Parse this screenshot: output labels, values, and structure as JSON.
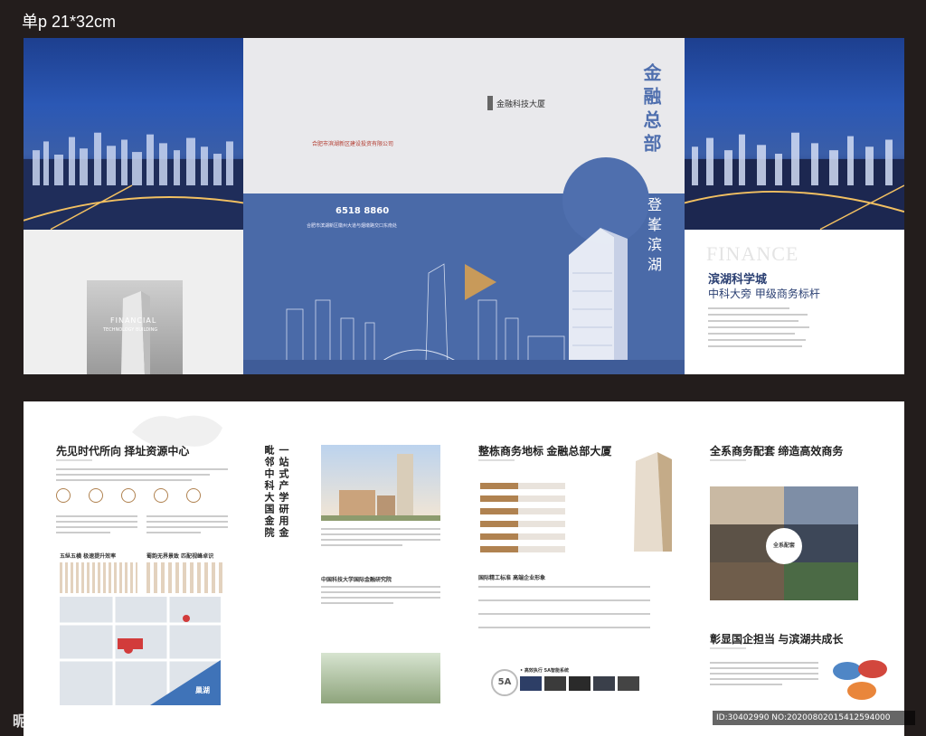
{
  "header": {
    "label": "单p  21*32cm"
  },
  "cover": {
    "logo_text": "金融科技大厦",
    "developer": "合肥市滨湖新区建设投资有限公司",
    "phone": "6518 8860",
    "address": "合肥市滨湖新区徽州大道与烟墩路交口东南处",
    "vertical_title": "金融总部",
    "vertical_subtitle": "登峯滨湖"
  },
  "back_panel": {
    "financial_line1": "FINANCIAL",
    "financial_line2": "TECHNOLOGY BUILDING"
  },
  "flap": {
    "finance_word": "FINANCE",
    "headline1": "滨湖科学城",
    "headline2": "中科大旁 甲级商务标杆"
  },
  "inner": {
    "s1_title": "先见时代所向 择址资源中心",
    "s1_sub1": "五纵五横 极速提升效率",
    "s1_sub2": "蜀韵无界景致 匹配视峰卓识",
    "map_label": "巢湖",
    "s2_vertical_a": "一站式产学研用金",
    "s2_vertical_b": "毗邻中科大国金院",
    "s2_sub": "中国科技大学国际金融研究院",
    "s3_title": "整栋商务地标 金融总部大厦",
    "s3_sub": "国际精工标准 高端企业形象",
    "s3_5a": "5A",
    "s3_5a_caption": "• 高效执行 5A智能系统",
    "s4_title": "全系商务配套 缔造高效商务",
    "s4_center": "全系配套",
    "s5_title": "彰显国企担当 与滨湖共成长"
  },
  "watermark": {
    "brand": "昵享网 www.nipic.cn",
    "id": "ID:30402990 NO:20200802015412594000"
  },
  "colors": {
    "accent_blue": "#4a6aa8",
    "gold": "#b08250",
    "background": "#231d1c"
  }
}
